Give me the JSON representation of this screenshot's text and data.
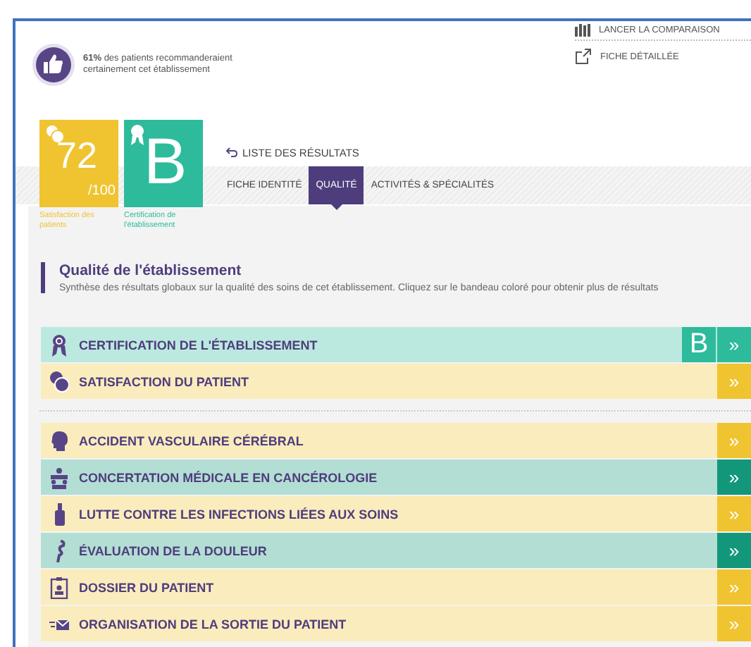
{
  "recommendation": {
    "text": "**61%** des patients recommanderaient certainement cet établissement"
  },
  "links": [
    {
      "label": "LANCER LA COMPARAISON",
      "kind": "compare"
    },
    {
      "label": "FICHE DÉTAILLÉE",
      "kind": "detail"
    }
  ],
  "scores": [
    {
      "kind": "satisfaction",
      "value": "72",
      "suffix": "/100",
      "caption": "Satisfaction des patients",
      "color": "#f0c330"
    },
    {
      "kind": "certification",
      "value": "B",
      "caption": "Certification de l'établissement",
      "color": "#2dbb9c"
    }
  ],
  "back_link": "LISTE DES RÉSULTATS",
  "tabs": [
    {
      "label": "FICHE IDENTITÉ",
      "selected": false
    },
    {
      "label": "QUALITÉ",
      "selected": true
    },
    {
      "label": "ACTIVITÉS & SPÉCIALITÉS",
      "selected": false
    }
  ],
  "section": {
    "title": "Qualité de l'établissement",
    "description": "Synthèse des résultats globaux sur la qualité des soins de cet établissement. Cliquez sur le bandeau coloré pour obtenir plus de résultats"
  },
  "groups": [
    [
      {
        "label": "CERTIFICATION DE L'ÉTABLISSEMENT",
        "grade": "B",
        "color": "#2dbb9c"
      },
      {
        "label": "SATISFACTION DU PATIENT",
        "color": "#f0c330"
      }
    ],
    [
      {
        "label": "ACCIDENT VASCULAIRE CÉRÉBRAL",
        "color": "#f0c330"
      },
      {
        "label": "CONCERTATION MÉDICALE EN CANCÉROLOGIE",
        "color": "#13977a"
      },
      {
        "label": "LUTTE CONTRE LES INFECTIONS LIÉES AUX SOINS",
        "color": "#f0c330"
      },
      {
        "label": "ÉVALUATION DE LA DOULEUR",
        "color": "#13977a"
      },
      {
        "label": "DOSSIER DU PATIENT",
        "color": "#f0c330"
      },
      {
        "label": "ORGANISATION DE LA SORTIE DU PATIENT",
        "color": "#f0c330"
      }
    ]
  ],
  "arrow_glyph": "»"
}
